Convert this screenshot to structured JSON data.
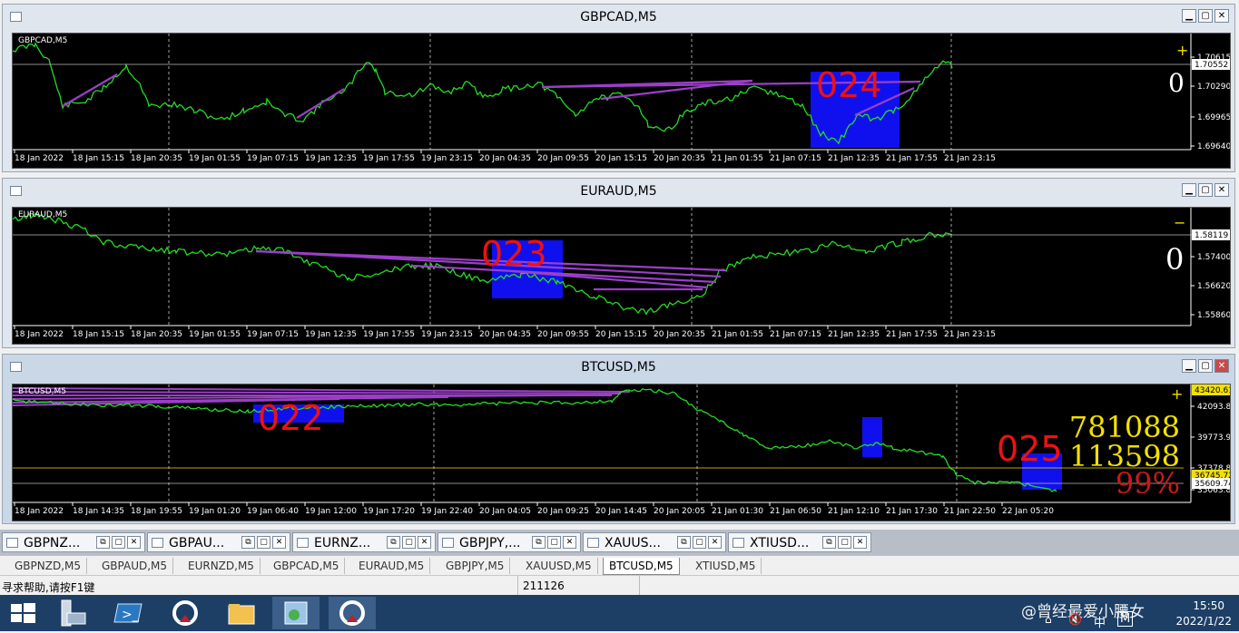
{
  "windows": [
    {
      "title": "GBPCAD,M5",
      "symbol_label": "GBPCAD,M5",
      "number_label": "024",
      "right_value": "0",
      "sign": "+",
      "price_labels": [
        "1.70615",
        "1.70552",
        "1.70290",
        "1.69965",
        "1.69640"
      ],
      "time_labels": [
        "18 Jan 2022",
        "18 Jan 15:15",
        "18 Jan 20:35",
        "19 Jan 01:55",
        "19 Jan 07:15",
        "19 Jan 12:35",
        "19 Jan 17:55",
        "19 Jan 23:15",
        "20 Jan 04:35",
        "20 Jan 09:55",
        "20 Jan 15:15",
        "20 Jan 20:35",
        "21 Jan 01:55",
        "21 Jan 07:15",
        "21 Jan 12:35",
        "21 Jan 17:55",
        "21 Jan 23:15"
      ]
    },
    {
      "title": "EURAUD,M5",
      "symbol_label": "EURAUD,M5",
      "number_label": "023",
      "right_value": "0",
      "sign": "−",
      "price_labels": [
        "1.58119",
        "1.57400",
        "1.56620",
        "1.55860"
      ],
      "time_labels": [
        "18 Jan 2022",
        "18 Jan 15:15",
        "18 Jan 20:35",
        "19 Jan 01:55",
        "19 Jan 07:15",
        "19 Jan 12:35",
        "19 Jan 17:55",
        "19 Jan 23:15",
        "20 Jan 04:35",
        "20 Jan 09:55",
        "20 Jan 15:15",
        "20 Jan 20:35",
        "21 Jan 01:55",
        "21 Jan 07:15",
        "21 Jan 12:35",
        "21 Jan 17:55",
        "21 Jan 23:15"
      ]
    },
    {
      "title": "BTCUSD,M5",
      "symbol_label": "BTCUSD,M5",
      "number_label_a": "022",
      "number_label_b": "025",
      "stat1": "781088",
      "stat2": "113598",
      "stat3": "99%",
      "sign": "+",
      "price_labels": [
        "43420.61",
        "42093.80",
        "39773.90",
        "37378.80",
        "36745.72",
        "35609.74",
        "35063.80"
      ],
      "time_labels": [
        "18 Jan 2022",
        "18 Jan 14:35",
        "18 Jan 19:55",
        "19 Jan 01:20",
        "19 Jan 06:40",
        "19 Jan 12:00",
        "19 Jan 17:20",
        "19 Jan 22:40",
        "20 Jan 04:05",
        "20 Jan 09:25",
        "20 Jan 14:45",
        "20 Jan 20:05",
        "21 Jan 01:30",
        "21 Jan 06:50",
        "21 Jan 12:10",
        "21 Jan 17:30",
        "21 Jan 22:50",
        "22 Jan 05:20"
      ]
    }
  ],
  "chart_tabs": [
    "GBPNZ...",
    "GBPAU...",
    "EURNZ...",
    "GBPJPY,...",
    "XAUUS...",
    "XTIUSD..."
  ],
  "symbol_tabs": [
    "GBPNZD,M5",
    "GBPAUD,M5",
    "EURNZD,M5",
    "GBPCAD,M5",
    "EURAUD,M5",
    "GBPJPY,M5",
    "XAUUSD,M5",
    "BTCUSD,M5",
    "XTIUSD,M5"
  ],
  "status": {
    "help": "寻求帮助,请按F1键",
    "value": "211126"
  },
  "tray": {
    "time": "15:50",
    "date": "2022/1/22",
    "ime": "中",
    "watermark": "@曾经最爱小腰女"
  },
  "colors": {
    "line": "#22dd22",
    "box": "#1010ee",
    "label": "#ee1111",
    "trend": "#9b3fc8",
    "stat": "#f2e000"
  }
}
